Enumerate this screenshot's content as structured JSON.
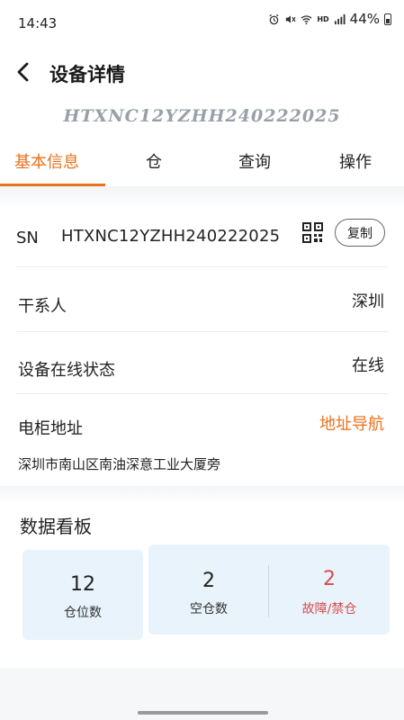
{
  "status_bar": {
    "time": "14:43",
    "network_label": "HD",
    "battery": "44%",
    "icons": [
      "alarm-icon",
      "mute-icon",
      "wifi-icon",
      "signal-icon",
      "battery-icon"
    ]
  },
  "header": {
    "title": "设备详情",
    "back_icon": "chevron-left-icon"
  },
  "device_id": "HTXNC12YZHH240222025",
  "tabs": [
    {
      "label": "基本信息",
      "active": true
    },
    {
      "label": "仓",
      "active": false
    },
    {
      "label": "查询",
      "active": false
    },
    {
      "label": "操作",
      "active": false
    }
  ],
  "basic_info": {
    "sn_label": "SN",
    "sn_value": "HTXNC12YZHH240222025",
    "qr_icon": "qr-code-icon",
    "copy_label": "复制",
    "contact_label": "干系人",
    "contact_value": "深圳",
    "online_label": "设备在线状态",
    "online_value": "在线",
    "cabinet_label": "电柜地址",
    "nav_label": "地址导航",
    "address": "深圳市南山区南油深意工业大厦旁"
  },
  "dashboard": {
    "title": "数据看板",
    "stats": [
      {
        "value": "12",
        "label": "仓位数"
      },
      {
        "value": "2",
        "label": "空仓数"
      },
      {
        "value": "2",
        "label": "故障/禁仓"
      }
    ]
  },
  "colors": {
    "accent": "#e8731d",
    "fault": "#d94b4b",
    "card_bg": "#e8f3fb"
  }
}
